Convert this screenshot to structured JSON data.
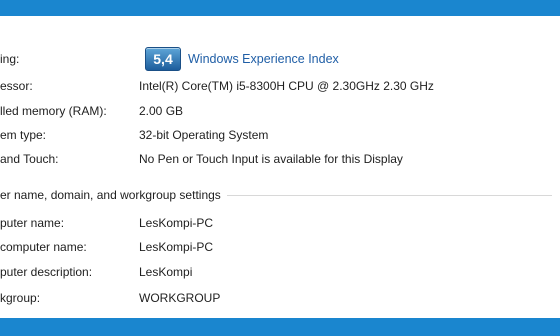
{
  "system": {
    "rating_label": "ing:",
    "wei_score": "5,4",
    "wei_link": "Windows Experience Index",
    "rows": [
      {
        "label": "essor:",
        "value": "Intel(R) Core(TM) i5-8300H CPU @ 2.30GHz   2.30 GHz"
      },
      {
        "label": "lled memory (RAM):",
        "value": "2.00 GB"
      },
      {
        "label": "em type:",
        "value": "32-bit Operating System"
      },
      {
        "label": "and Touch:",
        "value": "No Pen or Touch Input is available for this Display"
      }
    ]
  },
  "computer": {
    "section_title": "er name, domain, and workgroup settings",
    "rows": [
      {
        "label": "puter name:",
        "value": "LesKompi-PC"
      },
      {
        "label": "computer name:",
        "value": "LesKompi-PC"
      },
      {
        "label": "puter description:",
        "value": "LesKompi"
      },
      {
        "label": "kgroup:",
        "value": "WORKGROUP"
      }
    ]
  },
  "colors": {
    "frame": "#1a86cf",
    "link": "#1f5ea6"
  }
}
